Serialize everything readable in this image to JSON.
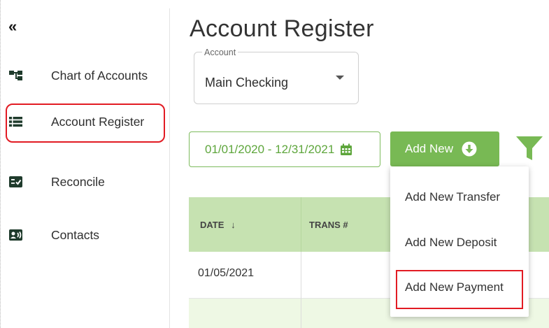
{
  "sidebar": {
    "collapse_glyph": "«",
    "items": [
      {
        "label": "Chart of Accounts",
        "icon": "hierarchy-icon"
      },
      {
        "label": "Account Register",
        "icon": "list-icon",
        "selected": true
      },
      {
        "label": "Reconcile",
        "icon": "checklist-icon"
      },
      {
        "label": "Contacts",
        "icon": "contact-card-icon"
      }
    ]
  },
  "main": {
    "title": "Account Register",
    "account": {
      "legend": "Account",
      "value": "Main Checking"
    },
    "date_range": "01/01/2020 - 12/31/2021",
    "add_new_label": "Add New",
    "table": {
      "headers": [
        "DATE",
        "TRANS #"
      ],
      "rows": [
        {
          "date": "01/05/2021"
        }
      ]
    },
    "add_new_menu": [
      "Add New Transfer",
      "Add New Deposit",
      "Add New Payment"
    ]
  },
  "colors": {
    "accent_green": "#78b954",
    "header_green": "#c6e2b1",
    "highlight_red": "#e21b23"
  }
}
